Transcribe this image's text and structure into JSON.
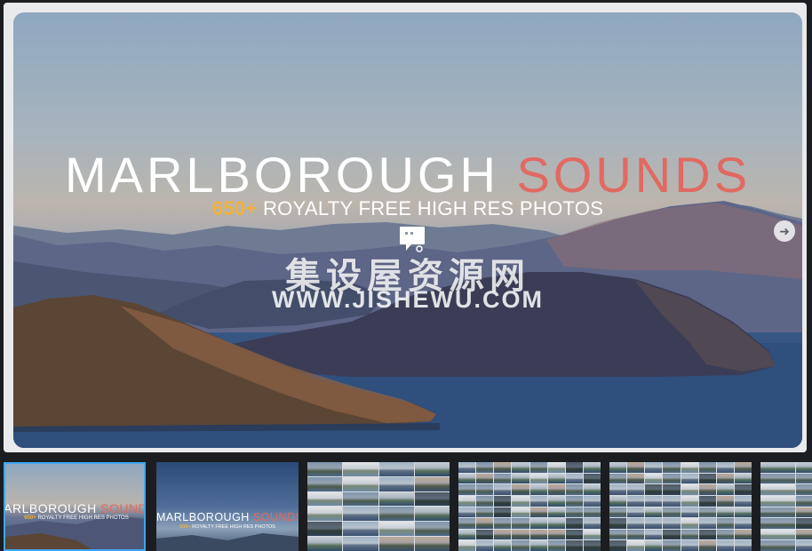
{
  "hero": {
    "title_main": "MARLBOROUGH",
    "title_accent": "SOUNDS",
    "subtitle_count": "650+",
    "subtitle_rest": "ROYALTY FREE HIGH RES PHOTOS",
    "watermark_cn": "集设屋资源网",
    "watermark_url": "WWW.JISHEWU.COM",
    "next_icon": "arrow-right-icon"
  },
  "colors": {
    "accent": "#e06a62",
    "count": "#f2b23a",
    "active_thumb_border": "#3ea7f0"
  },
  "thumbnails": [
    {
      "kind": "cover-crop",
      "title_main": "MARLBOROUGH",
      "title_accent": "SOUNDS",
      "sub_count": "650+",
      "sub_rest": "ROYALTY FREE HIGH RES PHOTOS",
      "active": true
    },
    {
      "kind": "cover-full",
      "title_main": "MARLBOROUGH",
      "title_accent": "SOUNDS",
      "sub_count": "650+",
      "sub_rest": "ROYALTY FREE HIGH RES PHOTOS",
      "active": false
    },
    {
      "kind": "photo-grid",
      "active": false
    },
    {
      "kind": "photo-grid",
      "active": false
    },
    {
      "kind": "photo-grid",
      "active": false
    },
    {
      "kind": "photo-grid",
      "active": false
    }
  ]
}
